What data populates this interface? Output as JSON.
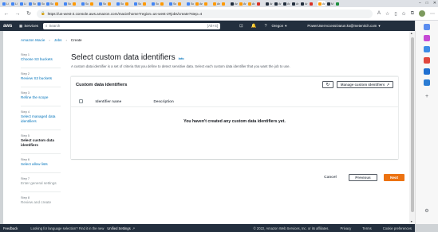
{
  "browser": {
    "tabs": [
      {
        "label": "Li",
        "icon": "blue"
      },
      {
        "label": "Li",
        "icon": "blue"
      },
      {
        "label": "Li",
        "icon": "blue"
      },
      {
        "label": "Sc",
        "icon": "blue"
      },
      {
        "label": "Sc",
        "icon": "blue"
      },
      {
        "label": "Sc",
        "icon": "blue"
      },
      {
        "label": "",
        "icon": "orange"
      },
      {
        "label": "Sc",
        "icon": "blue"
      },
      {
        "label": "",
        "icon": "orange"
      },
      {
        "label": "Sc",
        "icon": "blue"
      },
      {
        "label": "",
        "icon": "orange"
      },
      {
        "label": "Sc",
        "icon": "blue"
      },
      {
        "label": "",
        "icon": "orange"
      },
      {
        "label": "Sc",
        "icon": "blue"
      },
      {
        "label": "",
        "icon": "orange"
      },
      {
        "label": "Sc",
        "icon": "blue"
      },
      {
        "label": "",
        "icon": "orange"
      },
      {
        "label": "Sc",
        "icon": "blue"
      },
      {
        "label": "",
        "icon": "orange"
      },
      {
        "label": "Sc",
        "icon": "blue"
      },
      {
        "label": "",
        "icon": "orange"
      },
      {
        "label": "Sc",
        "icon": "blue"
      },
      {
        "label": "An",
        "icon": "orange"
      },
      {
        "label": "",
        "icon": "orange"
      },
      {
        "label": "An",
        "icon": "orange"
      },
      {
        "label": "",
        "icon": "orange"
      },
      {
        "label": "An",
        "icon": "dark"
      },
      {
        "label": "Ar",
        "icon": "orange"
      },
      {
        "label": "Ar",
        "icon": "orange"
      },
      {
        "label": "",
        "icon": "red"
      },
      {
        "label": "Ar",
        "icon": "dark"
      },
      {
        "label": "Ar",
        "icon": "dark"
      },
      {
        "label": "Ar",
        "icon": "dark"
      },
      {
        "label": "Ar",
        "icon": "dark"
      },
      {
        "label": "Ar",
        "icon": "dark"
      },
      {
        "label": "",
        "icon": "red"
      },
      {
        "label": "Ar",
        "icon": "orange"
      },
      {
        "label": "M",
        "icon": "dark"
      },
      {
        "label": "",
        "icon": "green"
      }
    ],
    "url": "https://us-west-2.console.aws.amazon.com/macie/home?region=us-west-2#jobs/create?step=4"
  },
  "awsnav": {
    "logo": "aws",
    "services_label": "Services",
    "search_placeholder": "Search",
    "search_shortcut": "[Alt+S]",
    "region": "Oregon",
    "account": "PowerUserAccess/varun.ks@metenrich.com"
  },
  "breadcrumb": {
    "items": [
      "Amazon Macie",
      "Jobs",
      "Create"
    ]
  },
  "steps": [
    {
      "num": "Step 1",
      "label": "Choose S3 buckets",
      "state": "link"
    },
    {
      "num": "Step 2",
      "label": "Review S3 buckets",
      "state": "link"
    },
    {
      "num": "Step 3",
      "label": "Refine the scope",
      "state": "link"
    },
    {
      "num": "Step 4",
      "label": "Select managed data identifiers",
      "state": "link"
    },
    {
      "num": "Step 5",
      "label": "Select custom data identifiers",
      "state": "current"
    },
    {
      "num": "Step 6",
      "label": "Select allow lists",
      "state": "link"
    },
    {
      "num": "Step 7",
      "label": "Enter general settings",
      "state": "disabled"
    },
    {
      "num": "Step 8",
      "label": "Review and create",
      "state": "disabled"
    }
  ],
  "main": {
    "title": "Select custom data identifiers",
    "info": "Info",
    "description": "A custom data identifier is a set of criteria that you define to detect sensitive data. Select each custom data identifier that you want the job to use."
  },
  "card": {
    "title": "Custom data identifiers",
    "manage_label": "Manage custom identifiers",
    "columns": [
      "Identifier name",
      "Description"
    ],
    "empty_text": "You haven't created any custom data identifiers yet."
  },
  "actions": {
    "cancel": "Cancel",
    "previous": "Previous",
    "next": "Next"
  },
  "footer": {
    "feedback": "Feedback",
    "language_prompt": "Looking for language selection? Find it in the new",
    "unified_settings": "Unified Settings",
    "copyright": "© 2022, Amazon Web Services, Inc. or its affiliates.",
    "privacy": "Privacy",
    "terms": "Terms",
    "cookies": "Cookie preferences"
  },
  "colors": {
    "aws_nav": "#232f3e",
    "link": "#0073bb",
    "primary": "#ec7211"
  }
}
